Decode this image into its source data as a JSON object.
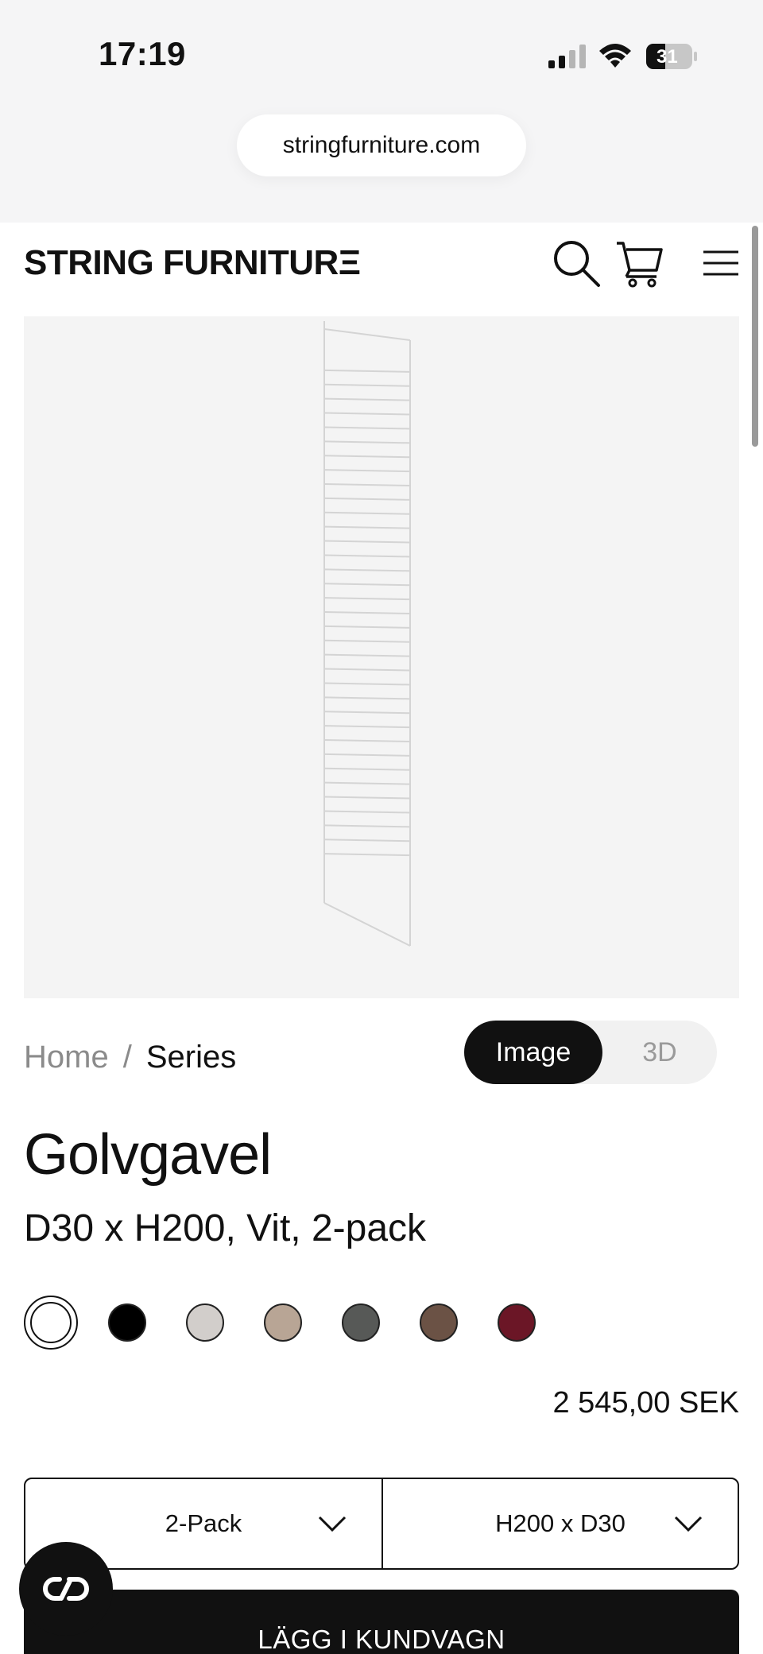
{
  "status_bar": {
    "time": "17:19",
    "battery_level": "31",
    "signal_icon": "cellular-signal-icon",
    "wifi_icon": "wifi-icon",
    "battery_icon": "battery-icon"
  },
  "browser": {
    "url": "stringfurniture.com"
  },
  "header": {
    "logo": "STRING FURNITURΞ",
    "icons": [
      "search-icon",
      "cart-icon",
      "menu-icon"
    ]
  },
  "breadcrumb": {
    "home": "Home",
    "separator": "/",
    "current": "Series"
  },
  "view_toggle": {
    "options": [
      "Image",
      "3D"
    ],
    "selected": "Image"
  },
  "product": {
    "title": "Golvgavel",
    "subtitle": "D30 x H200, Vit, 2-pack",
    "price": "2 545,00 SEK",
    "colors": [
      {
        "name": "white",
        "hex": "#ffffff",
        "selected": true
      },
      {
        "name": "black",
        "hex": "#000000"
      },
      {
        "name": "light-grey",
        "hex": "#d2cecb"
      },
      {
        "name": "beige",
        "hex": "#b8a595"
      },
      {
        "name": "dark-grey",
        "hex": "#575957"
      },
      {
        "name": "brown",
        "hex": "#6b5245"
      },
      {
        "name": "burgundy",
        "hex": "#6b1626"
      }
    ]
  },
  "options": {
    "pack": "2-Pack",
    "size": "H200 x D30"
  },
  "cta": {
    "add_to_cart": "LÄGG I KUNDVAGN"
  },
  "chat": {
    "icon": "chat-link-icon"
  }
}
